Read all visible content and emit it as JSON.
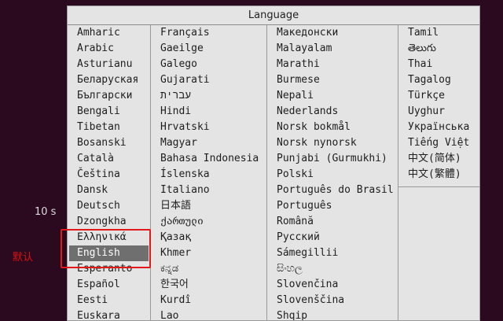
{
  "menu": {
    "title": "Language",
    "columns": [
      [
        "Amharic",
        "Arabic",
        "Asturianu",
        "Беларуская",
        "Български",
        "Bengali",
        "Tibetan",
        "Bosanski",
        "Català",
        "Čeština",
        "Dansk",
        "Deutsch",
        "Dzongkha",
        "Ελληνικά",
        "English",
        "Esperanto",
        "Español",
        "Eesti",
        "Euskara"
      ],
      [
        "Français",
        "Gaeilge",
        "Galego",
        "Gujarati",
        "עברית",
        "Hindi",
        "Hrvatski",
        "Magyar",
        "Bahasa Indonesia",
        "Íslenska",
        "Italiano",
        "日本語",
        "ქართული",
        "Қазақ",
        "Khmer",
        "ಕನ್ನಡ",
        "한국어",
        "Kurdî",
        "Lao"
      ],
      [
        "Македонски",
        "Malayalam",
        "Marathi",
        "Burmese",
        "Nepali",
        "Nederlands",
        "Norsk bokmål",
        "Norsk nynorsk",
        "Punjabi (Gurmukhi)",
        "Polski",
        "Português do Brasil",
        "Português",
        "Română",
        "Русский",
        "Sámegillii",
        "සිංහල",
        "Slovenčina",
        "Slovenščina",
        "Shqip"
      ],
      [
        "Tamil",
        "తెలుగు",
        "Thai",
        "Tagalog",
        "Türkçe",
        "Uyghur",
        "Українська",
        "Tiếng Việt",
        "中文(简体)",
        "中文(繁體)"
      ]
    ],
    "selected": "English"
  },
  "timer": {
    "text": "10 s"
  },
  "annotation": {
    "label": "默认",
    "color": "#e01010"
  }
}
